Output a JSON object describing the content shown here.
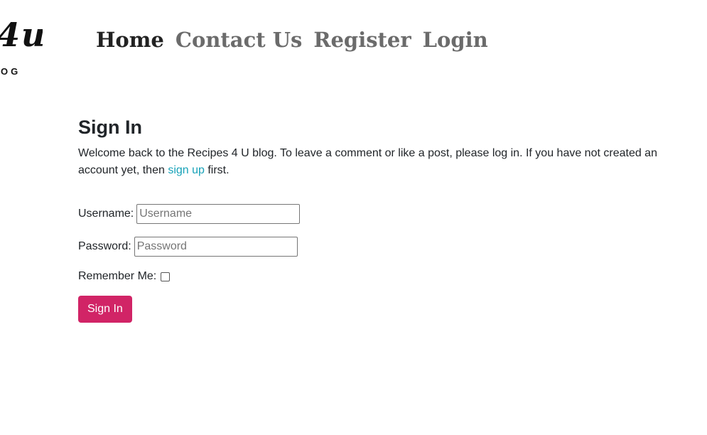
{
  "brand": {
    "logo_script": "4u",
    "logo_sub": "OG"
  },
  "nav": {
    "items": [
      {
        "label": "Home",
        "active": true
      },
      {
        "label": "Contact Us",
        "active": false
      },
      {
        "label": "Register",
        "active": false
      },
      {
        "label": "Login",
        "active": false
      }
    ]
  },
  "signin": {
    "title": "Sign In",
    "intro_before": "Welcome back to the Recipes 4 U blog. To leave a comment or like a post, please log in. If you have not created an account yet, then ",
    "intro_link": "sign up",
    "intro_after": " first.",
    "username_label": "Username:",
    "username_placeholder": "Username",
    "username_value": "",
    "password_label": "Password:",
    "password_placeholder": "Password",
    "password_value": "",
    "remember_label": "Remember Me:",
    "remember_checked": false,
    "submit_label": "Sign In"
  },
  "colors": {
    "accent_button": "#d12466",
    "link": "#17a2b8",
    "nav_active": "#222222",
    "nav_inactive": "#6b6b6b"
  }
}
